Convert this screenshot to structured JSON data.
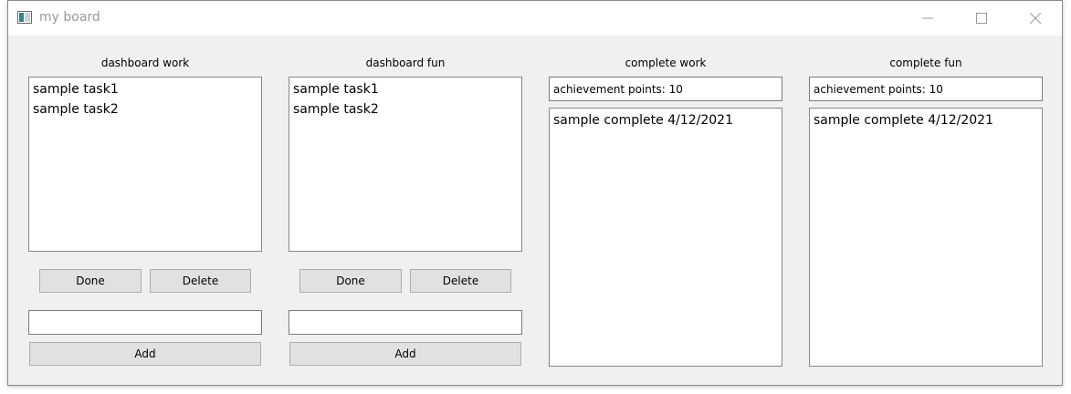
{
  "window": {
    "title": "my board",
    "controls": {
      "minimize": "minimize-icon",
      "maximize": "maximize-icon",
      "close": "close-icon"
    }
  },
  "dashboard_work": {
    "title": "dashboard work",
    "items": [
      "sample task1",
      "sample task2"
    ],
    "done_label": "Done",
    "delete_label": "Delete",
    "input_value": "",
    "add_label": "Add"
  },
  "dashboard_fun": {
    "title": "dashboard fun",
    "items": [
      "sample task1",
      "sample task2"
    ],
    "done_label": "Done",
    "delete_label": "Delete",
    "input_value": "",
    "add_label": "Add"
  },
  "complete_work": {
    "title": "complete work",
    "points": "achievement points: 10",
    "items": [
      "sample complete 4/12/2021"
    ]
  },
  "complete_fun": {
    "title": "complete fun",
    "points": "achievement points: 10",
    "items": [
      "sample complete 4/12/2021"
    ]
  },
  "colors": {
    "window_bg": "#f0f0f0",
    "titlebar_bg": "#ffffff",
    "button_bg": "#e1e1e1",
    "border": "#828790"
  }
}
